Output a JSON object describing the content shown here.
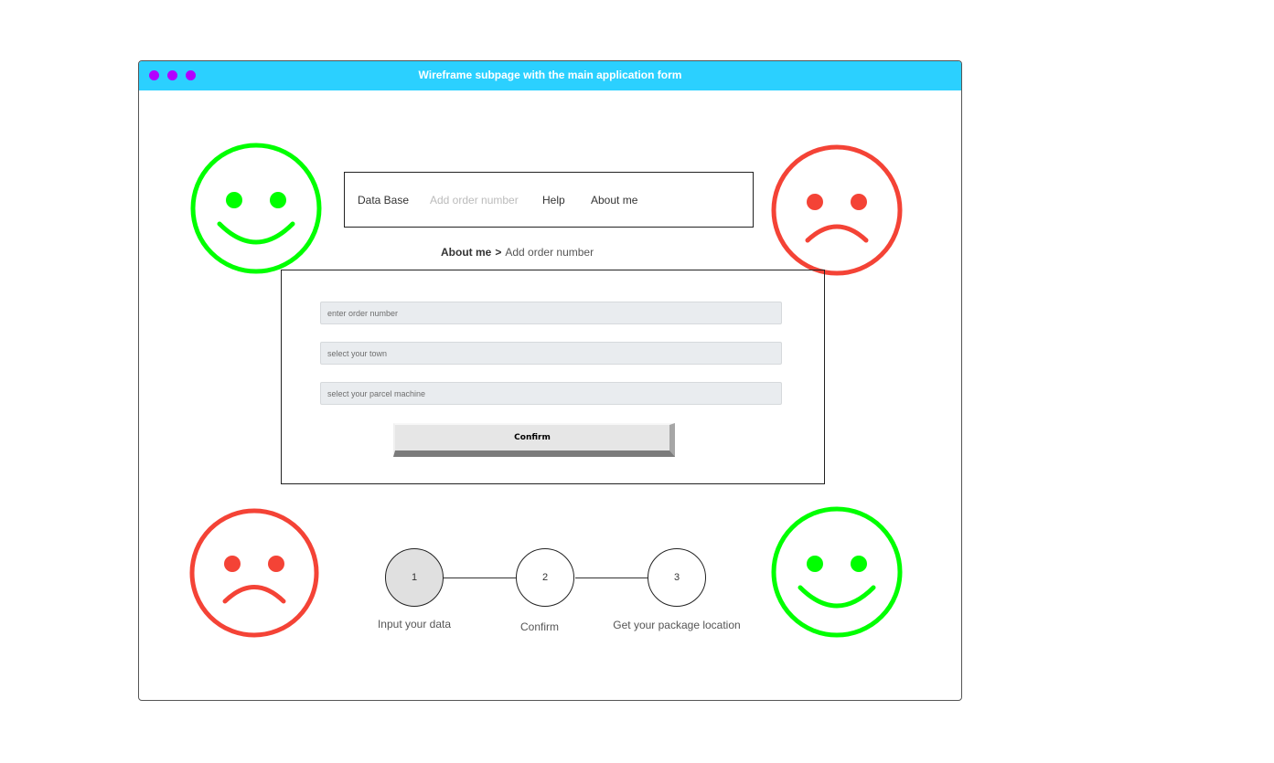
{
  "window": {
    "title": "Wireframe subpage with the main application form"
  },
  "colors": {
    "titlebar": "#2bd0ff",
    "window_dots": "#b200ff",
    "happy_face": "#00ff00",
    "sad_face": "#f44336"
  },
  "faces": [
    {
      "name": "top-left",
      "mood": "happy-face-icon"
    },
    {
      "name": "top-right",
      "mood": "sad-face-icon"
    },
    {
      "name": "bottom-left",
      "mood": "sad-face-icon"
    },
    {
      "name": "bottom-right",
      "mood": "happy-face-icon"
    }
  ],
  "nav": {
    "items": [
      {
        "label": "Data Base",
        "state": "normal"
      },
      {
        "label": "Add order number",
        "state": "current"
      },
      {
        "label": "Help",
        "state": "normal"
      },
      {
        "label": "About me",
        "state": "normal"
      }
    ]
  },
  "breadcrumb": {
    "parent": "About me",
    "separator": ">",
    "current": "Add order number"
  },
  "form": {
    "fields": [
      {
        "placeholder": "enter order number",
        "value": ""
      },
      {
        "placeholder": "select your town",
        "value": ""
      },
      {
        "placeholder": "select your parcel machine",
        "value": ""
      }
    ],
    "confirm_label": "Confirm"
  },
  "steps": [
    {
      "number": "1",
      "label": "Input your data",
      "active": true
    },
    {
      "number": "2",
      "label": "Confirm",
      "active": false
    },
    {
      "number": "3",
      "label": "Get your package location",
      "active": false
    }
  ]
}
